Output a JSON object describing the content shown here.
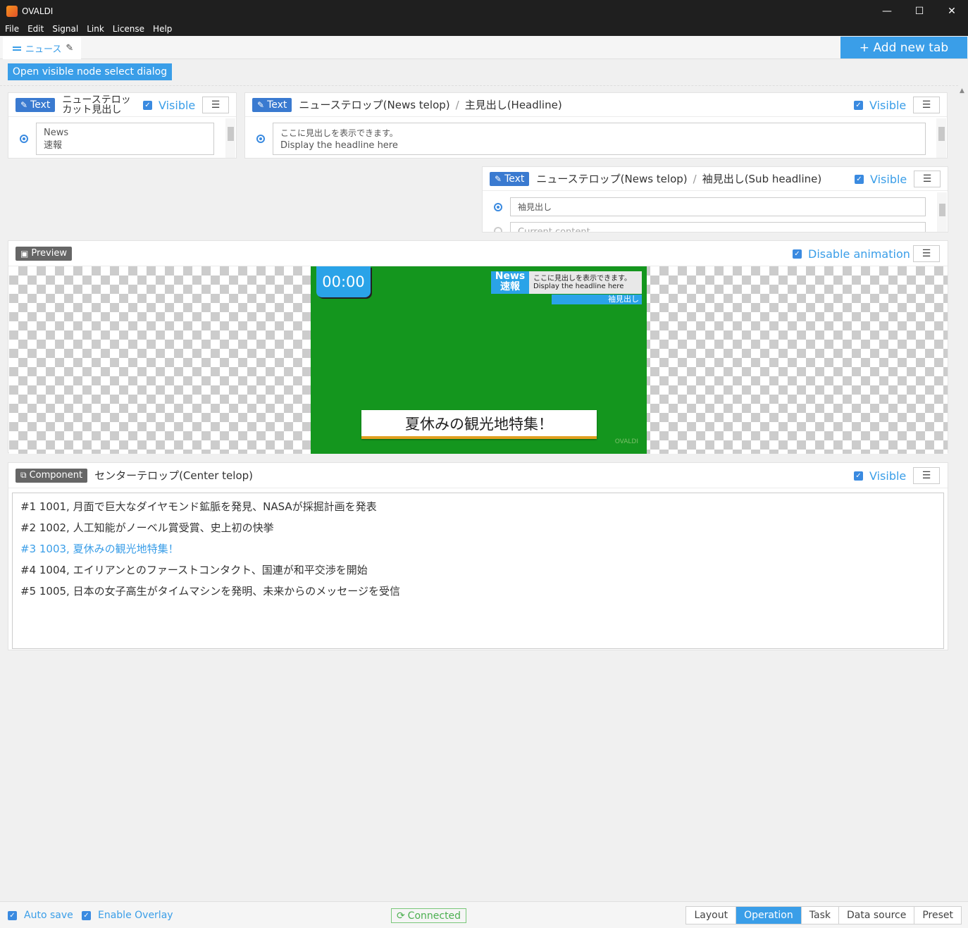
{
  "window": {
    "title": "OVALDI",
    "minimize": "—",
    "maximize": "☐",
    "close": "✕"
  },
  "menu": [
    "File",
    "Edit",
    "Signal",
    "Link",
    "License",
    "Help"
  ],
  "tabs": {
    "active_label": "ニュース",
    "add_label": "+ Add new tab"
  },
  "toolbar": {
    "open_dialog": "Open visible node select dialog"
  },
  "common": {
    "visible_label": "Visible",
    "menu_icon": "☰",
    "text_badge": "Text"
  },
  "panel_cut": {
    "title_line1": "ニューステロッ",
    "title_line2": "カット見出し",
    "value_line1": "News",
    "value_line2": "速報"
  },
  "panel_headline": {
    "crumb_parent": "ニューステロップ(News telop)",
    "crumb_child": "主見出し(Headline)",
    "value_line1": "ここに見出しを表示できます。",
    "value_line2": "Display the headline here"
  },
  "panel_sub": {
    "crumb_parent": "ニューステロップ(News telop)",
    "crumb_child": "袖見出し(Sub headline)",
    "value": "袖見出し",
    "placeholder": "Current content"
  },
  "preview": {
    "badge": "Preview",
    "disable_animation": "Disable animation",
    "clock": "00:00",
    "news_line1": "News",
    "news_line2": "速報",
    "headline_line1": "ここに見出しを表示できます。",
    "headline_line2": "Display the headline here",
    "sub": "袖見出し",
    "center_telop": "夏休みの観光地特集！",
    "watermark": "OVALDI"
  },
  "component": {
    "badge": "Component",
    "crumb": "センターテロップ(Center telop)",
    "items": [
      "#1 1001, 月面で巨大なダイヤモンド鉱脈を発見、NASAが採掘計画を発表",
      "#2 1002, 人工知能がノーベル賞受賞、史上初の快挙",
      "#3 1003, 夏休みの観光地特集！",
      "#4 1004, エイリアンとのファーストコンタクト、国連が和平交渉を開始",
      "#5 1005, 日本の女子高生がタイムマシンを発明、未来からのメッセージを受信"
    ],
    "active_index": 2
  },
  "status": {
    "auto_save": "Auto save",
    "enable_overlay": "Enable Overlay",
    "connected": "Connected",
    "modes": [
      "Layout",
      "Operation",
      "Task",
      "Data source",
      "Preset"
    ],
    "active_mode": "Operation"
  },
  "colors": {
    "accent": "#3a9ee8",
    "badge": "#3a7ad0",
    "chroma": "#14961e",
    "connected": "#4caf50"
  }
}
